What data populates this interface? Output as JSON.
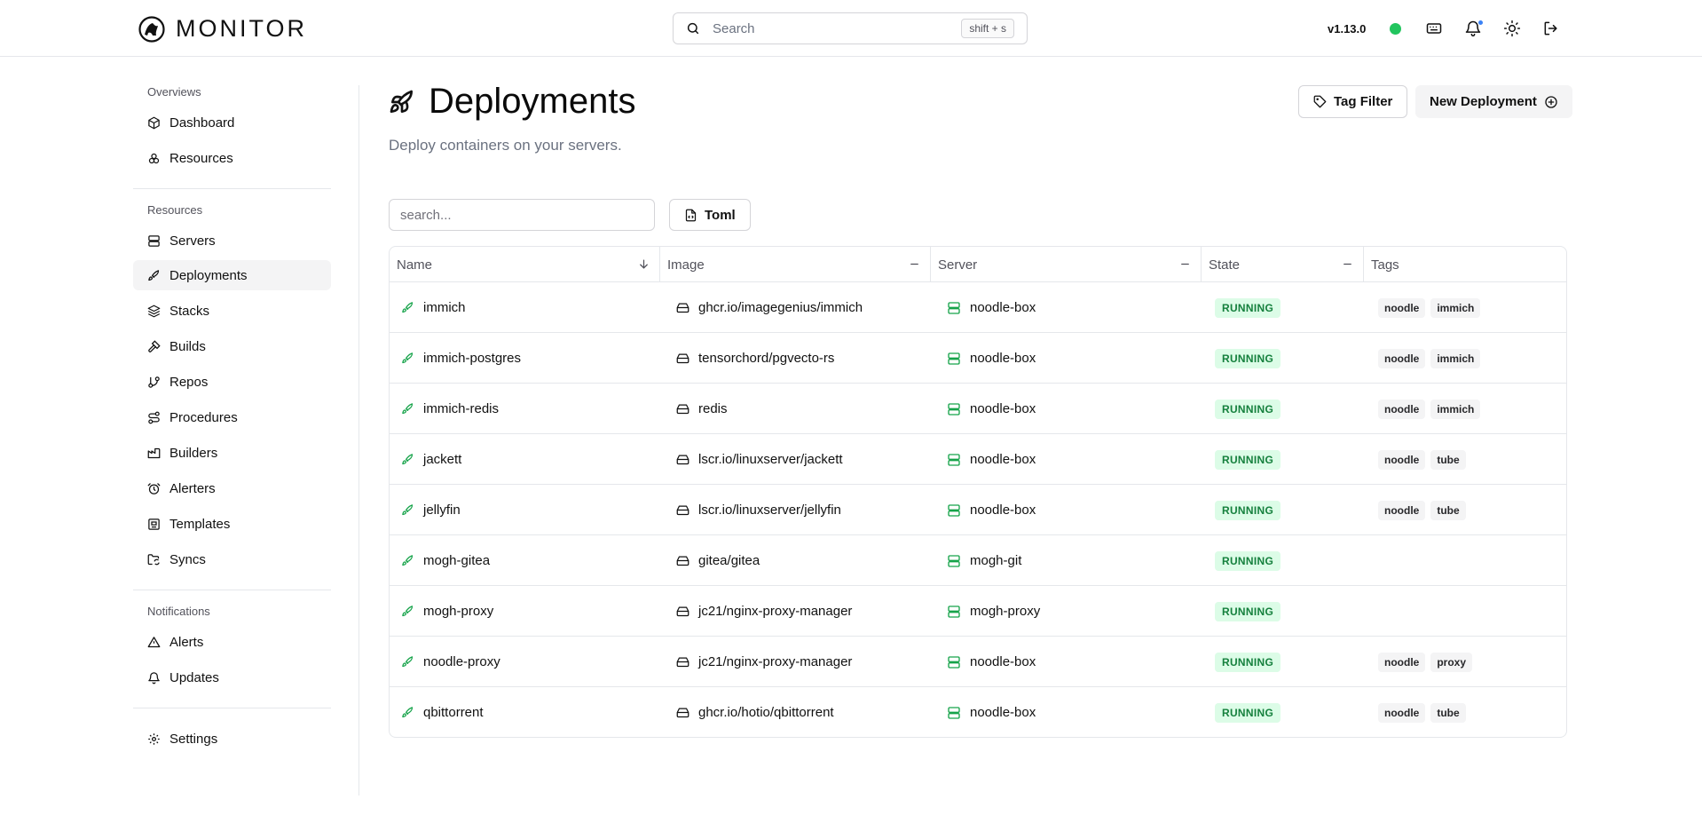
{
  "header": {
    "brand": "MONITOR",
    "search_placeholder": "Search",
    "search_shortcut": "shift + s",
    "version": "v1.13.0",
    "status_color": "#22c55e"
  },
  "sidebar": {
    "sections": [
      {
        "heading": "Overviews",
        "items": [
          {
            "label": "Dashboard",
            "icon": "box-icon"
          },
          {
            "label": "Resources",
            "icon": "boxes-icon"
          }
        ]
      },
      {
        "heading": "Resources",
        "items": [
          {
            "label": "Servers",
            "icon": "server-icon"
          },
          {
            "label": "Deployments",
            "icon": "rocket-icon",
            "active": true
          },
          {
            "label": "Stacks",
            "icon": "layers-icon"
          },
          {
            "label": "Builds",
            "icon": "hammer-icon"
          },
          {
            "label": "Repos",
            "icon": "git-branch-icon"
          },
          {
            "label": "Procedures",
            "icon": "route-icon"
          },
          {
            "label": "Builders",
            "icon": "factory-icon"
          },
          {
            "label": "Alerters",
            "icon": "alarm-clock-icon"
          },
          {
            "label": "Templates",
            "icon": "template-icon"
          },
          {
            "label": "Syncs",
            "icon": "folder-sync-icon"
          }
        ]
      },
      {
        "heading": "Notifications",
        "items": [
          {
            "label": "Alerts",
            "icon": "alert-triangle-icon"
          },
          {
            "label": "Updates",
            "icon": "bell-icon"
          }
        ]
      },
      {
        "heading": "",
        "items": [
          {
            "label": "Settings",
            "icon": "settings-icon"
          }
        ]
      }
    ]
  },
  "main": {
    "title": "Deployments",
    "subtitle": "Deploy containers on your servers.",
    "tag_filter_label": "Tag Filter",
    "new_deployment_label": "New Deployment",
    "filter_placeholder": "search...",
    "toml_label": "Toml",
    "columns": [
      "Name",
      "Image",
      "Server",
      "State",
      "Tags"
    ],
    "state_colors": {
      "running_bg": "#dcfce7",
      "running_text": "#15803d"
    },
    "rows": [
      {
        "name": "immich",
        "image": "ghcr.io/imagegenius/immich",
        "server": "noodle-box",
        "state": "RUNNING",
        "tags": [
          "noodle",
          "immich"
        ]
      },
      {
        "name": "immich-postgres",
        "image": "tensorchord/pgvecto-rs",
        "server": "noodle-box",
        "state": "RUNNING",
        "tags": [
          "noodle",
          "immich"
        ]
      },
      {
        "name": "immich-redis",
        "image": "redis",
        "server": "noodle-box",
        "state": "RUNNING",
        "tags": [
          "noodle",
          "immich"
        ]
      },
      {
        "name": "jackett",
        "image": "lscr.io/linuxserver/jackett",
        "server": "noodle-box",
        "state": "RUNNING",
        "tags": [
          "noodle",
          "tube"
        ]
      },
      {
        "name": "jellyfin",
        "image": "lscr.io/linuxserver/jellyfin",
        "server": "noodle-box",
        "state": "RUNNING",
        "tags": [
          "noodle",
          "tube"
        ]
      },
      {
        "name": "mogh-gitea",
        "image": "gitea/gitea",
        "server": "mogh-git",
        "state": "RUNNING",
        "tags": []
      },
      {
        "name": "mogh-proxy",
        "image": "jc21/nginx-proxy-manager",
        "server": "mogh-proxy",
        "state": "RUNNING",
        "tags": []
      },
      {
        "name": "noodle-proxy",
        "image": "jc21/nginx-proxy-manager",
        "server": "noodle-box",
        "state": "RUNNING",
        "tags": [
          "noodle",
          "proxy"
        ]
      },
      {
        "name": "qbittorrent",
        "image": "ghcr.io/hotio/qbittorrent",
        "server": "noodle-box",
        "state": "RUNNING",
        "tags": [
          "noodle",
          "tube"
        ]
      }
    ]
  }
}
